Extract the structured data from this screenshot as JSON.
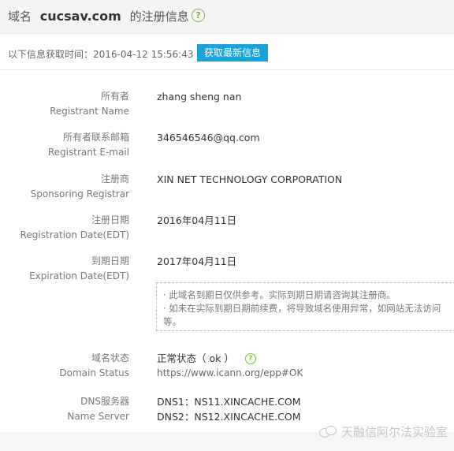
{
  "header": {
    "prefix": "域名",
    "domain": "cucsav.com",
    "suffix": "的注册信息",
    "help_icon": "question-circle-icon"
  },
  "fetch": {
    "label": "以下信息获取时间：",
    "time": "2016-04-12 15:56:43",
    "button": "获取最新信息"
  },
  "fields": {
    "owner": {
      "cn": "所有者",
      "en": "Registrant Name",
      "value": "zhang sheng nan"
    },
    "email": {
      "cn": "所有者联系邮箱",
      "en": "Registrant E-mail",
      "value": "346546546@qq.com"
    },
    "registrar": {
      "cn": "注册商",
      "en": "Sponsoring Registrar",
      "value": "XIN NET TECHNOLOGY CORPORATION"
    },
    "reg_date": {
      "cn": "注册日期",
      "en": "Registration Date(EDT)",
      "value": "2016年04月11日"
    },
    "exp_date": {
      "cn": "到期日期",
      "en": "Expiration Date(EDT)",
      "value": "2017年04月11日"
    },
    "status": {
      "cn": "域名状态",
      "en": "Domain Status",
      "value": "正常状态（ ok ）",
      "url": "https://www.icann.org/epp#OK"
    },
    "dns": {
      "cn": "DNS服务器",
      "en": "Name Server",
      "dns1": "DNS1：NS11.XINCACHE.COM",
      "dns2": "DNS2：NS12.XINCACHE.COM"
    }
  },
  "note": {
    "line1": "· 此域名到期日仅供参考。实际到期日期请咨询其注册商。",
    "line2": "· 如未在实际到期日期前续费，将导致域名使用异常，如网站无法访问",
    "line3": "等。"
  },
  "watermark": {
    "text": "天融信阿尔法实验室",
    "icon": "wechat-icon"
  },
  "colors": {
    "accent": "#19a3d8",
    "help_green": "#7bbf2a"
  }
}
